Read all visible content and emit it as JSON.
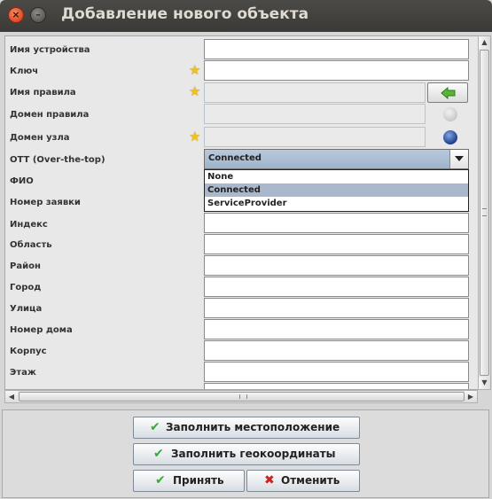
{
  "window": {
    "title": "Добавление нового объекта",
    "close_glyph": "×",
    "minimize_glyph": "–"
  },
  "form": {
    "fields": [
      {
        "label": "Имя устройства",
        "value": "",
        "required": false,
        "enabled": true
      },
      {
        "label": "Ключ",
        "value": "",
        "required": true,
        "enabled": true
      },
      {
        "label": "Имя правила",
        "value": "",
        "required": true,
        "enabled": false
      },
      {
        "label": "Домен правила",
        "value": "",
        "required": false,
        "enabled": false
      },
      {
        "label": "Домен узла",
        "value": "",
        "required": true,
        "enabled": false
      },
      {
        "label": "OTT (Over-the-top)",
        "value": "Connected",
        "type": "combo"
      },
      {
        "label": "ФИО",
        "value": ""
      },
      {
        "label": "Номер заявки",
        "value": ""
      },
      {
        "label": "Индекс",
        "value": ""
      },
      {
        "label": "Область",
        "value": ""
      },
      {
        "label": "Район",
        "value": ""
      },
      {
        "label": "Город",
        "value": ""
      },
      {
        "label": "Улица",
        "value": ""
      },
      {
        "label": "Номер дома",
        "value": ""
      },
      {
        "label": "Корпус",
        "value": ""
      },
      {
        "label": "Этаж",
        "value": ""
      }
    ],
    "ott_options": [
      "None",
      "Connected",
      "ServiceProvider"
    ],
    "ott_selected": "Connected",
    "icons": {
      "required": "star-icon",
      "fill_rule": "green-left-arrow-icon",
      "rule_domain_status": "globe-disabled-icon",
      "node_domain_status": "globe-icon"
    },
    "star_color": "#f3c11d"
  },
  "buttons": {
    "fill_location": "Заполнить местоположение",
    "fill_geocoords": "Заполнить геокоординаты",
    "accept": "Принять",
    "cancel": "Отменить"
  },
  "colors": {
    "titlebar": "#3b3a37",
    "close_button": "#de4b22",
    "combo_selected": "#9eb3cb",
    "check_green": "#3aa83a",
    "cancel_red": "#cc2222"
  }
}
